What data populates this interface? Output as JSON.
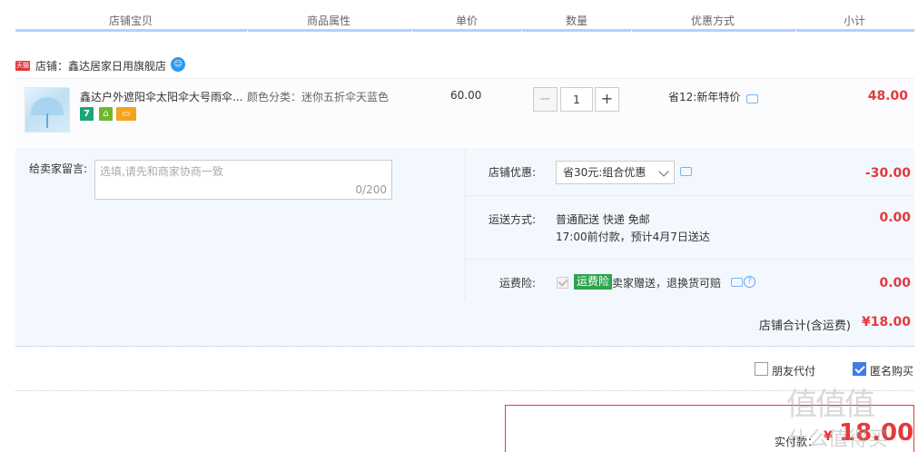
{
  "header": {
    "shop": "店铺宝贝",
    "attr": "商品属性",
    "price": "单价",
    "qty": "数量",
    "discount": "优惠方式",
    "subtotal": "小计"
  },
  "shop": {
    "badge": "天猫",
    "name": "店铺：鑫达居家日用旗舰店"
  },
  "item": {
    "title": "鑫达户外遮阳伞太阳伞大号雨伞...",
    "attribute": "颜色分类：迷你五折伞天蓝色",
    "unit_price": "60.00",
    "quantity": "1",
    "minus": "−",
    "plus": "+",
    "promo": "省12:新年特价",
    "subtotal": "48.00",
    "service_icons": [
      "7",
      "⌂",
      "▭"
    ]
  },
  "message": {
    "label": "给卖家留言:",
    "placeholder": "选填,请先和商家协商一致",
    "counter": "0/200"
  },
  "coupon": {
    "label": "店铺优惠:",
    "selected": "省30元:组合优惠",
    "amount": "-30.00"
  },
  "shipping": {
    "label": "运送方式:",
    "line1": "普通配送 快递 免邮",
    "line2": "17:00前付款，预计4月7日送达",
    "amount": "0.00"
  },
  "insurance": {
    "label": "运费险:",
    "badge": "运费险",
    "text": "卖家赠送，退换货可赔",
    "help": "?",
    "amount": "0.00"
  },
  "shop_total": {
    "label": "店铺合计(含运费)",
    "value": "¥18.00"
  },
  "options": {
    "friend_pay": "朋友代付",
    "anonymous": "匿名购买",
    "anonymous_checked": true
  },
  "pay": {
    "label": "实付款：",
    "currency": "¥",
    "value": "18.00"
  },
  "watermark": {
    "logo": "值值值",
    "domain": "什么值得买"
  },
  "colors": {
    "accent_red": "#e4393c",
    "header_line": "#b2d1ff",
    "section_bg": "#f3f8fe",
    "check_blue": "#3d7de4"
  }
}
